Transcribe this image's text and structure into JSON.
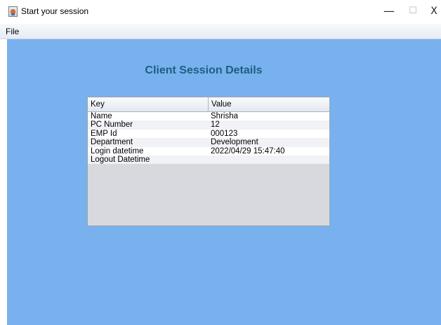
{
  "window": {
    "title": "Start your session",
    "minimize_glyph": "—",
    "maximize_glyph": "☐",
    "close_glyph": "X"
  },
  "menu": {
    "file_label": "File"
  },
  "main": {
    "heading": "Client Session Details",
    "background_color": "#79b1ee",
    "heading_color": "#1c5f80"
  },
  "table": {
    "columns": [
      "Key",
      "Value"
    ],
    "rows": [
      {
        "key": "Name",
        "value": "Shrisha"
      },
      {
        "key": "PC Number",
        "value": "12"
      },
      {
        "key": "EMP Id",
        "value": "000123"
      },
      {
        "key": "Department",
        "value": "Development"
      },
      {
        "key": "Login datetime",
        "value": "2022/04/29 15:47:40"
      },
      {
        "key": "Logout Datetime",
        "value": ""
      }
    ]
  }
}
